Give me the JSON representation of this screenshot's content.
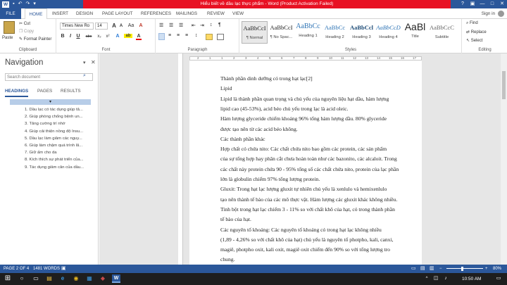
{
  "window": {
    "title": "Hiểu biết về dầu lạc thực phẩm - Word (Product Activation Failed)",
    "help": "?",
    "restore_ribbon": "▣",
    "minimize": "—",
    "maximize": "□",
    "close": "✕"
  },
  "qat": {
    "word": "W",
    "save": "▪",
    "undo": "↶",
    "redo": "↷",
    "more": "▾"
  },
  "tabs": [
    "FILE",
    "HOME",
    "INSERT",
    "DESIGN",
    "PAGE LAYOUT",
    "REFERENCES",
    "MAILINGS",
    "REVIEW",
    "VIEW"
  ],
  "active_tab": "HOME",
  "signin": "Sign in",
  "ribbon": {
    "clipboard": {
      "paste": "Paste",
      "cut": "Cut",
      "copy": "Copy",
      "format_painter": "Format Painter",
      "label": "Clipboard"
    },
    "font": {
      "font_name": "Times New Ro",
      "font_size": "14",
      "grow": "A",
      "shrink": "A",
      "case": "Aa",
      "clear": "A",
      "bold": "B",
      "italic": "I",
      "underline": "U",
      "strike": "abc",
      "subscript": "x₂",
      "superscript": "x²",
      "effects": "A",
      "highlight": "ab",
      "color": "A",
      "label": "Font"
    },
    "paragraph": {
      "label": "Paragraph",
      "pilcrow": "¶",
      "sort": "↕"
    },
    "styles": {
      "items": [
        {
          "preview": "AaBbCcI",
          "name": "¶ Normal"
        },
        {
          "preview": "AaBbCcI",
          "name": "¶ No Spac..."
        },
        {
          "preview": "AaBbCc",
          "name": "Heading 1"
        },
        {
          "preview": "AaBbCc",
          "name": "Heading 2"
        },
        {
          "preview": "AaBbCcl",
          "name": "Heading 3"
        },
        {
          "preview": "AaBbCcD",
          "name": "Heading 4"
        },
        {
          "preview": "AaBl",
          "name": "Title"
        },
        {
          "preview": "AaBbCcC",
          "name": "Subtitle"
        }
      ],
      "label": "Styles"
    },
    "editing": {
      "find": "Find",
      "replace": "Replace",
      "select": "Select",
      "label": "Editing"
    }
  },
  "nav": {
    "title": "Navigation",
    "search_placeholder": "Search document",
    "tabs": [
      "HEADINGS",
      "PAGES",
      "RESULTS"
    ],
    "active_tab": "HEADINGS",
    "items": [
      "1. Dầu lạc có tác dụng giúp tă...",
      "2. Giúp phòng chống bệnh un...",
      "3. Tăng cường trí nhớ",
      "4. Giúp cải thiện nồng độ Insu...",
      "5. Dầu lạc làm giảm các nguy...",
      "6. Giúp làm chậm quá trình lã...",
      "7. Giữ ấm cho da",
      "8. Kích thích sự phát triển của...",
      "9. Tác dụng giảm cân của dầu..."
    ]
  },
  "ruler_marks": [
    "2",
    "1",
    "1",
    "2",
    "3",
    "4",
    "5",
    "6",
    "7",
    "8",
    "9",
    "10",
    "11",
    "12",
    "13",
    "14",
    "15",
    "16",
    "17"
  ],
  "document": {
    "lines": [
      "Thành phần dinh dưỡng có trong hạt lạc[2]",
      " Lipid",
      "Lipid là thành phần quan trọng và chủ yếu của nguyên liệu hạt dầu, hàm lượng",
      "lipid cao (45-53%), acid béo chủ yếu trong lạc là acid oleic.",
      "Hàm lượng glyceride chiếm khoảng 96% tổng hàm lượng dầu. 80% glyceride",
      "được tạo nên từ các acid béo không.",
      " Các thành phần khác",
      "Hợp chất có chứa nito: Các chất chứa nito bao gồm các protein, các sản phẩm",
      "của sự tổng hợp hay phân cắt chưa hoàn toàn như các bazonito, các alcaloit. Trong",
      "các chất này protein chứa 90 - 95% tổng số các chất chứa nito, protein của lạc phần",
      "lớn là globulin chiếm 97% tổng lượng protein.",
      "Gluxit: Trong hạt lạc lượng gluxit tự nhiên chủ yếu là xenlulo và hemixenlulo",
      "tạo nên thành tế bào của các mô thực vật. Hàm lượng các gluxit khác không nhiều.",
      "Tinh bột trong hạt lạc chiếm 3 - 11% so với chất khô của hạt, có trong thành phần",
      "tế bào của hạt.",
      "Các nguyên tố khoáng: Các nguyên tố khoáng có trong hạt lạc không nhiều",
      "(1,89 - 4,26% so với chất khô của hạt) chủ yếu là nguyên tố photpho, kali, canxi,",
      "magiê, photpho oxit, kali oxit, magiê oxit chiếm đến 90% so với tổng lượng tro",
      "chung."
    ]
  },
  "status": {
    "page": "PAGE 2 OF 4",
    "words": "1481 WORDS",
    "zoom": "80%",
    "zoom_minus": "−",
    "zoom_plus": "+"
  },
  "taskbar": {
    "time": "10:50 AM",
    "start": "⊞",
    "search": "○",
    "taskview": "▭",
    "explorer": "▤",
    "edge": "e",
    "chrome": "◉",
    "store": "▦",
    "app": "◆",
    "word": "W",
    "up": "^",
    "net": "◫",
    "vol": "♪",
    "notif": "▭"
  }
}
